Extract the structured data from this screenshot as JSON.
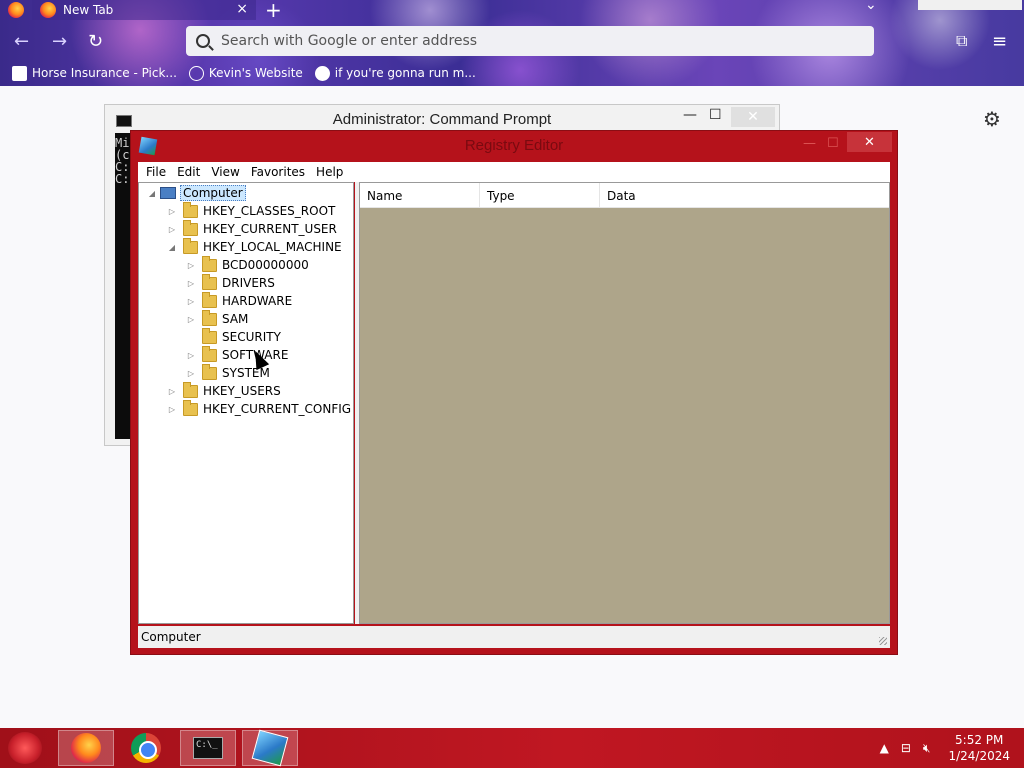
{
  "browser": {
    "tab_title": "New Tab",
    "tab_close": "×",
    "new_tab": "+",
    "search_placeholder": "Search with Google or enter address",
    "bookmarks": [
      {
        "label": "Horse Insurance - Pick..."
      },
      {
        "label": "Kevin's Website"
      },
      {
        "label": "if you're gonna run m..."
      }
    ],
    "nav": {
      "back": "←",
      "forward": "→",
      "reload": "↻"
    },
    "extensions_icon": "puzzle-icon",
    "menu_icon": "≡",
    "settings_icon": "⚙"
  },
  "cmd": {
    "title": "Administrator: Command Prompt",
    "min": "—",
    "max": "☐",
    "close": "✕",
    "lines": [
      "Mi",
      "(c",
      "",
      "C:",
      "",
      "C:"
    ]
  },
  "regedit": {
    "title": "Registry Editor",
    "min": "—",
    "max": "☐",
    "close": "✕",
    "menu": [
      "File",
      "Edit",
      "View",
      "Favorites",
      "Help"
    ],
    "tree": {
      "root": "Computer",
      "hives": [
        "HKEY_CLASSES_ROOT",
        "HKEY_CURRENT_USER",
        "HKEY_LOCAL_MACHINE"
      ],
      "hklm_children": [
        "BCD00000000",
        "DRIVERS",
        "HARDWARE",
        "SAM",
        "SECURITY",
        "SOFTWARE",
        "SYSTEM"
      ],
      "more_hives": [
        "HKEY_USERS",
        "HKEY_CURRENT_CONFIG"
      ]
    },
    "columns": [
      "Name",
      "Type",
      "Data"
    ],
    "status": "Computer",
    "list_bg_color": "#aea58a",
    "frame_color": "#b5121b"
  },
  "taskbar": {
    "time": "5:52 PM",
    "date": "1/24/2024",
    "items": [
      "firefox-icon",
      "chrome-icon",
      "cmd-icon",
      "regedit-icon"
    ],
    "tray": [
      "▲",
      "network-icon",
      "volume-muted-icon"
    ]
  }
}
